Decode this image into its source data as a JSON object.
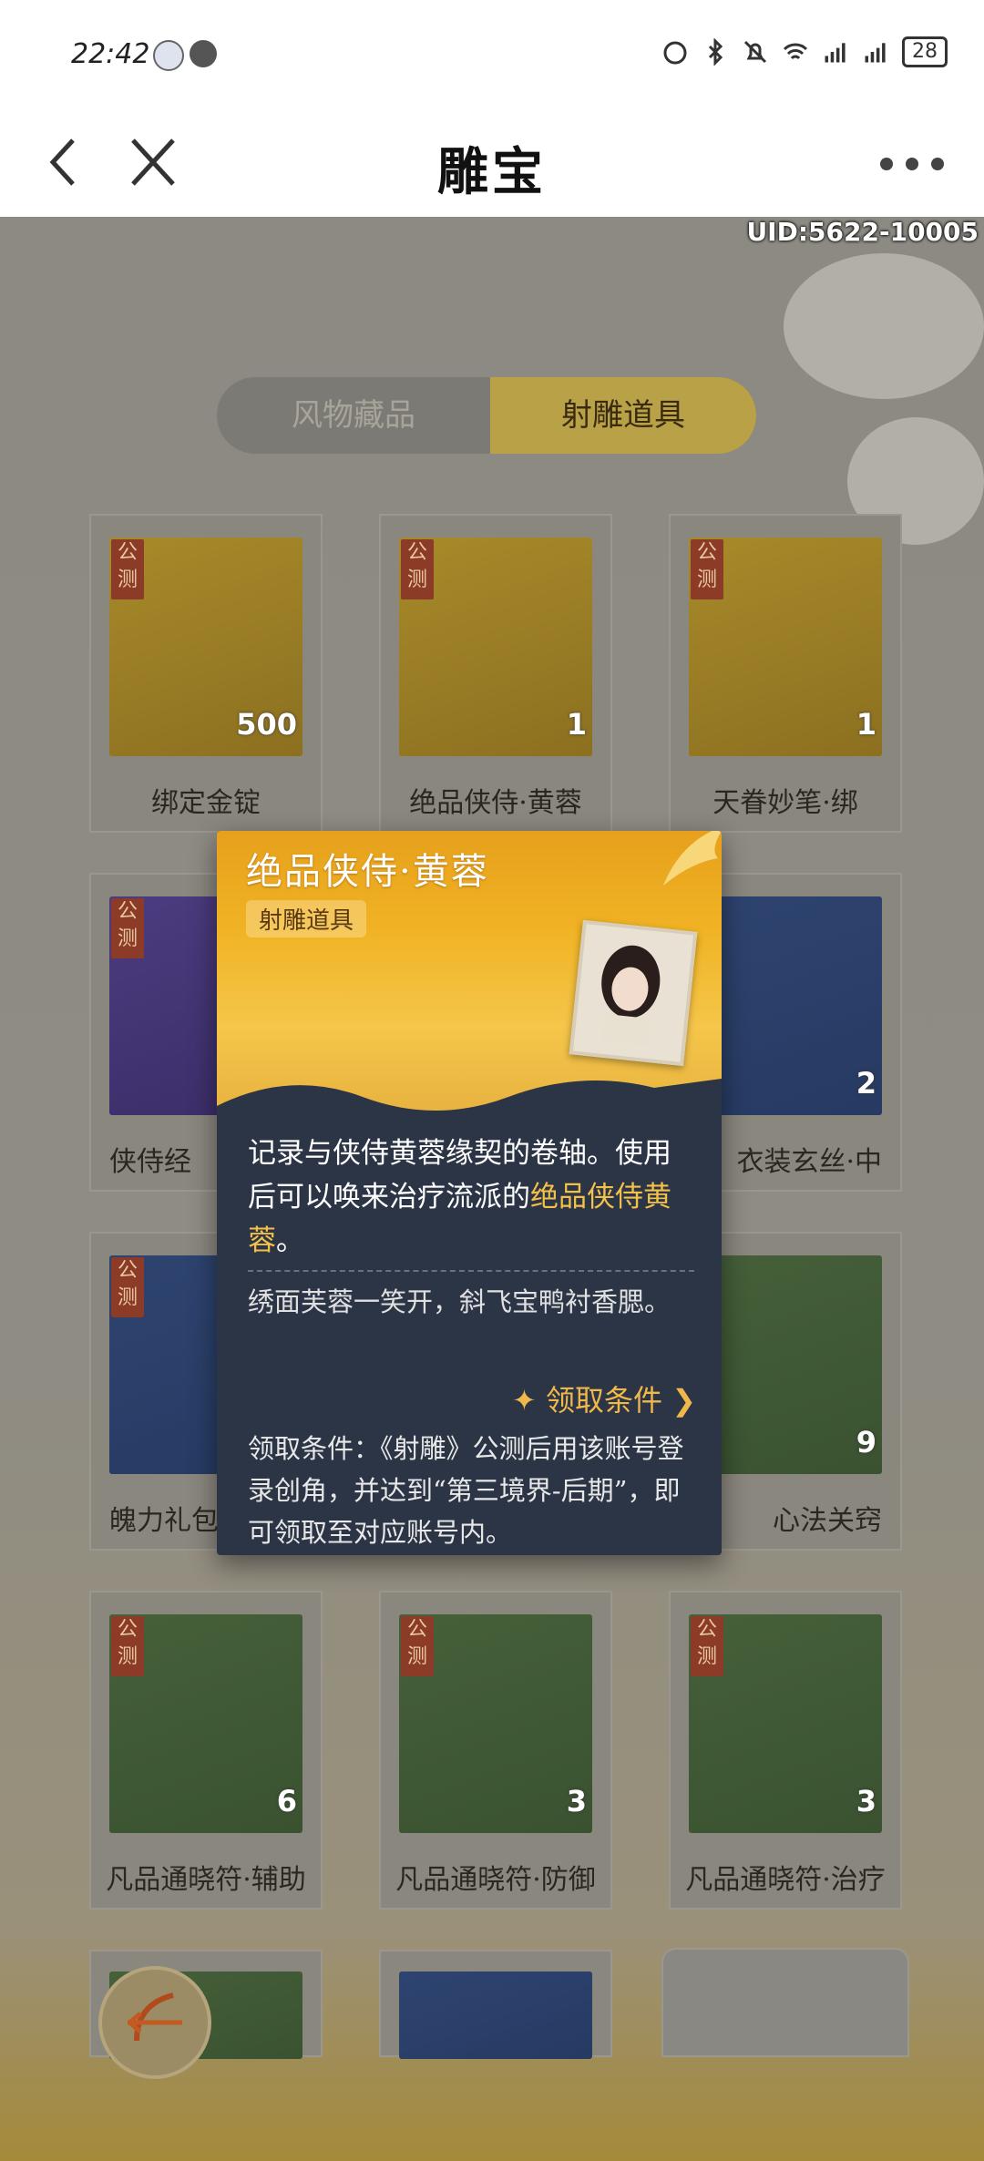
{
  "status_bar": {
    "time": "22:42",
    "battery": "28"
  },
  "nav": {
    "title": "雕宝"
  },
  "game": {
    "uid": "UID:5622-10005",
    "tabs": [
      {
        "label": "风物藏品",
        "active": false
      },
      {
        "label": "射雕道具",
        "active": true
      }
    ],
    "cards": [
      {
        "tag": "公测",
        "name": "绑定金锭",
        "count": "500",
        "theme": "gold"
      },
      {
        "tag": "公测",
        "name": "绝品侠侍·黄蓉",
        "count": "1",
        "theme": "gold"
      },
      {
        "tag": "公测",
        "name": "天眷妙笔·绑",
        "count": "1",
        "theme": "gold"
      },
      {
        "tag": "公测",
        "name": "侠侍经",
        "count": "",
        "theme": "purple"
      },
      {
        "tag": "",
        "name": "衣装玄丝·中",
        "count": "2",
        "theme": "blue"
      },
      {
        "tag": "公测",
        "name": "魄力礼包",
        "count": "",
        "theme": "blue"
      },
      {
        "tag": "",
        "name": "心法关窍",
        "count": "9",
        "theme": "green"
      },
      {
        "tag": "公测",
        "name": "凡品通晓符·辅助",
        "count": "6",
        "theme": "green"
      },
      {
        "tag": "公测",
        "name": "凡品通晓符·防御",
        "count": "3",
        "theme": "green"
      },
      {
        "tag": "公测",
        "name": "凡品通晓符·治疗",
        "count": "3",
        "theme": "green"
      }
    ]
  },
  "popup": {
    "title": "绝品侠侍·黄蓉",
    "category": "射雕道具",
    "desc_part1": "记录与侠侍黄蓉缘契的卷轴。使用后可以唤来治疗流派的",
    "desc_highlight": "绝品侠侍黄蓉",
    "desc_part2": "。",
    "flavor": "绣面芙蓉一笑开，斜飞宝鸭衬香腮。",
    "condition_link": "领取条件",
    "condition_text": "领取条件：《射雕》公测后用该账号登录创角，并达到“第三境界-后期”，即可领取至对应账号内。"
  },
  "colors": {
    "accent_gold": "#f3c04a",
    "popup_bg": "#2c3546",
    "tag_red": "#8b3b28"
  }
}
